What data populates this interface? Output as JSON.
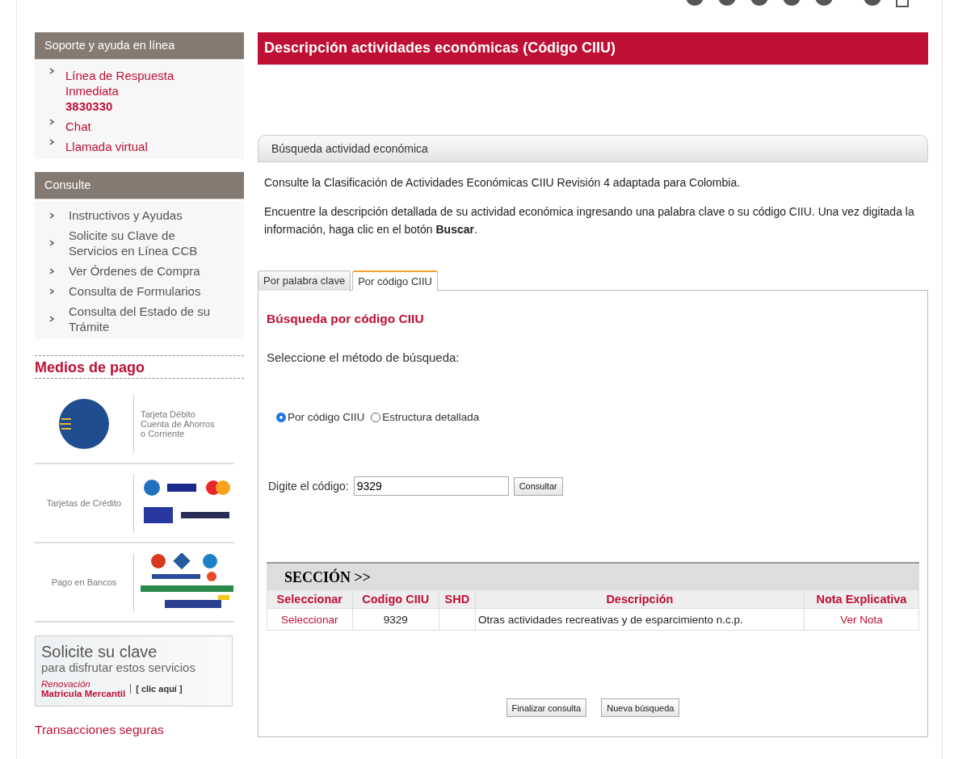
{
  "sidebar": {
    "sections": [
      {
        "title": "Soporte y ayuda en línea",
        "kind": "links",
        "items": [
          {
            "label": "Línea de Respuesta Inmediata",
            "detail": "3830330"
          },
          {
            "label": "Chat"
          },
          {
            "label": "Llamada virtual"
          }
        ]
      },
      {
        "title": "Consulte",
        "kind": "plain",
        "items": [
          {
            "label": "Instructivos y Ayudas"
          },
          {
            "label": "Solicite su Clave de Servicios en Línea CCB"
          },
          {
            "label": "Ver Órdenes de Compra"
          },
          {
            "label": "Consulta de Formularios"
          },
          {
            "label": "Consulta del Estado de su Trámite"
          }
        ]
      }
    ],
    "payment": {
      "title": "Medios de pago",
      "rows": [
        {
          "kind": "pse",
          "label": "Tarjeta Débito Cuenta de Ahorros o Corriente"
        },
        {
          "kind": "cards",
          "label": "Tarjetas de Crédito"
        },
        {
          "kind": "banks",
          "label": "Pago en Bancos"
        }
      ]
    },
    "banner": {
      "title": "Solicite su clave",
      "subtitle": "para disfrutar estos servicios",
      "tag_line1": "Renovación",
      "tag_line2": "Matricula Mercantil",
      "action": "[ clic aquí ]"
    },
    "secure_link": "Transacciones seguras"
  },
  "main": {
    "title": "Descripción actividades económicas (Código CIIU)",
    "panel_title": "Búsqueda actividad económica",
    "intro": "Consulte la Clasificación de Actividades Económicas CIIU Revisión 4 adaptada para Colombia.",
    "instructions": "Encuentre la descripción detallada de su actividad económica ingresando una palabra clave o su código CIIU. Una vez digitada la información, haga clic en el botón **Buscar**.",
    "tabs": [
      {
        "label": "Por palabra clave",
        "selected": false
      },
      {
        "label": "Por código CIIU",
        "selected": true
      }
    ],
    "form": {
      "heading": "Búsqueda por código CIIU",
      "method_label": "Seleccione el método de búsqueda:",
      "methods": [
        {
          "label": "Por código CIIU",
          "selected": true
        },
        {
          "label": "Estructura detallada",
          "selected": false
        }
      ],
      "code_label": "Digite el código:",
      "code_value": "9329",
      "submit": "Consultar"
    },
    "results": {
      "title": "SECCIÓN >>",
      "columns": [
        "Seleccionar",
        "Codigo CIIU",
        "SHD",
        "Descripción",
        "Nota Explicativa"
      ],
      "rows": [
        {
          "select": "Seleccionar",
          "code": "9329",
          "description": "Otras actividades recreativas y de esparcimiento n.c.p.",
          "note": "Ver Nota"
        }
      ]
    },
    "buttons": [
      "Finalizar consulta",
      "Nueva búsqueda"
    ]
  }
}
